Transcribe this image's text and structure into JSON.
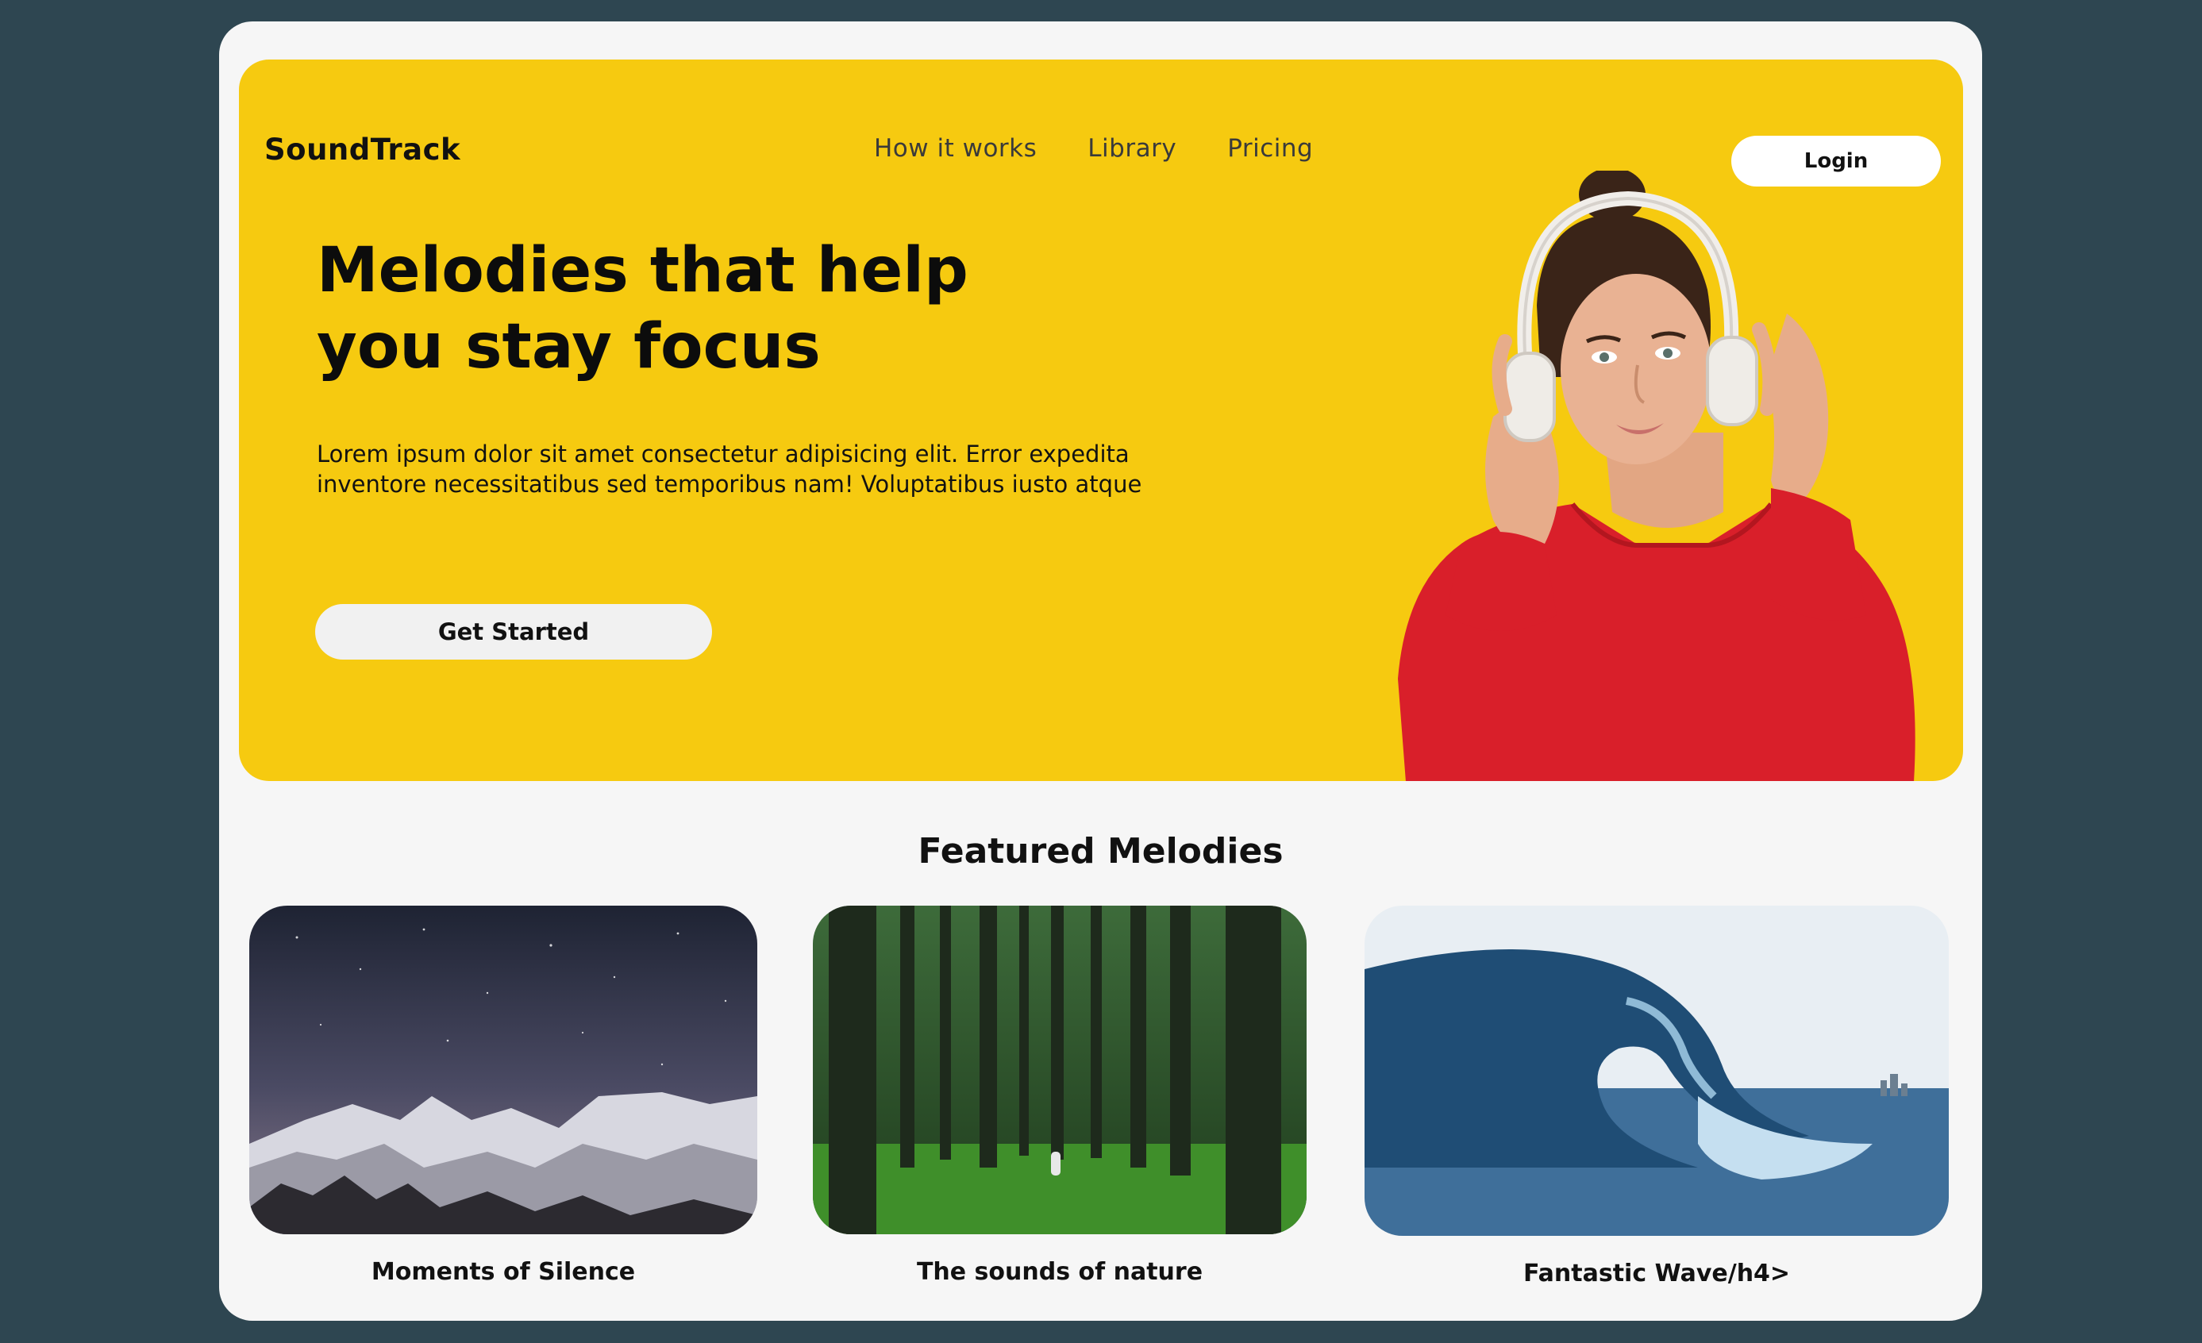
{
  "brand": "SoundTrack",
  "nav": {
    "items": [
      {
        "label": "How it works"
      },
      {
        "label": "Library"
      },
      {
        "label": "Pricing"
      }
    ],
    "login_label": "Login"
  },
  "hero": {
    "headline_line1": "Melodies that help",
    "headline_line2": "you stay focus",
    "body": "Lorem ipsum dolor sit amet consectetur adipisicing elit. Error expedita inventore necessitatibus sed temporibus nam! Voluptatibus iusto atque",
    "cta_label": "Get Started"
  },
  "featured": {
    "title": "Featured Melodies",
    "cards": [
      {
        "caption": "Moments of Silence"
      },
      {
        "caption": "The sounds of nature"
      },
      {
        "caption": "Fantastic Wave/h4>"
      }
    ]
  },
  "colors": {
    "background": "#2e4651",
    "card": "#f6f6f6",
    "hero": "#f6ca10"
  }
}
